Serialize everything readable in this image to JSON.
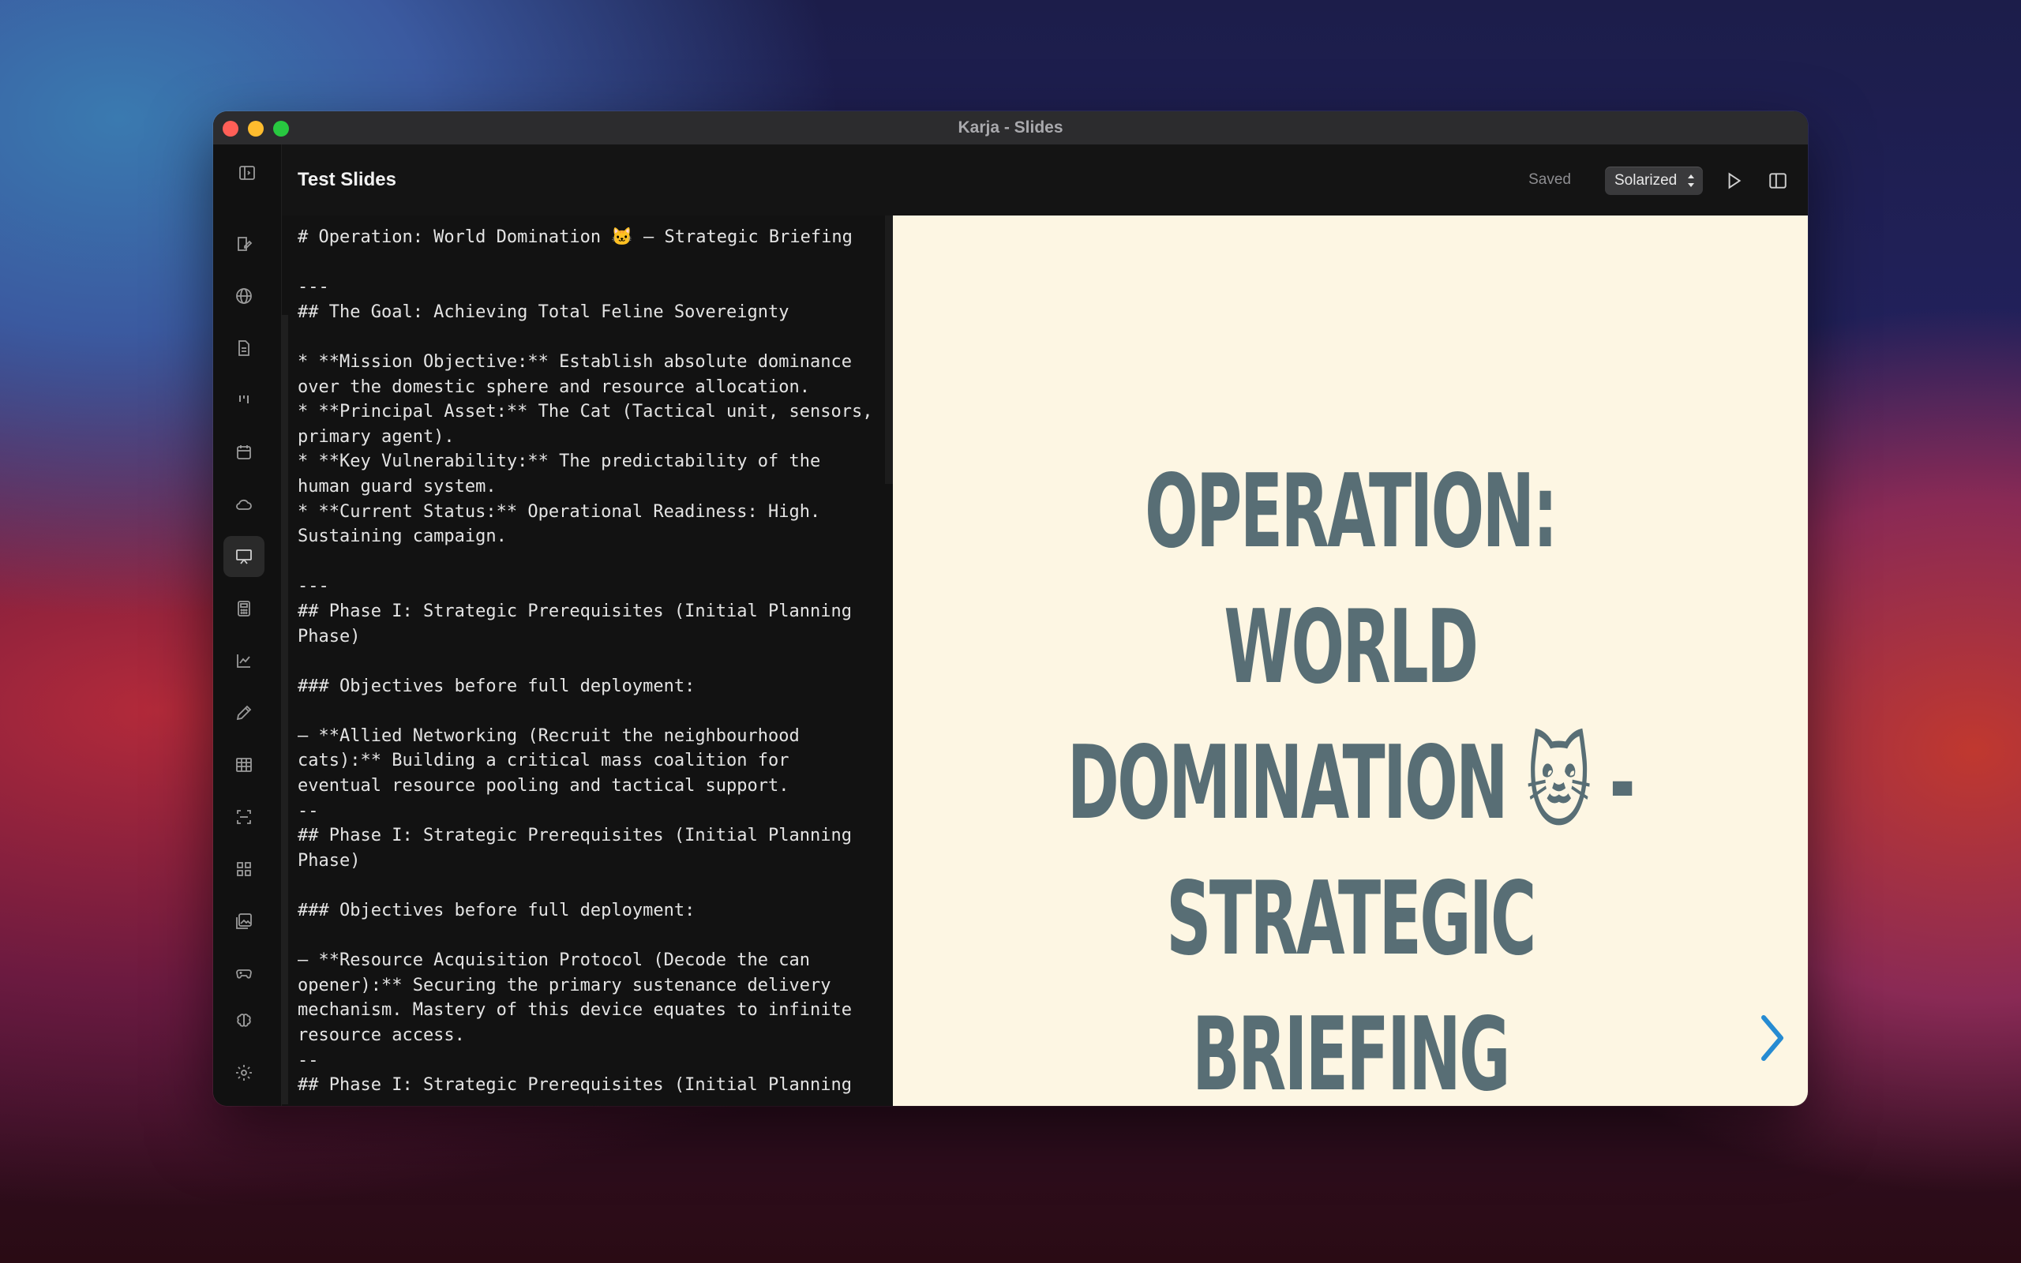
{
  "window": {
    "title": "Karja - Slides"
  },
  "header": {
    "doc_title": "Test Slides",
    "save_status": "Saved",
    "theme_select": {
      "selected": "Solarized"
    }
  },
  "sidebar": {
    "items": [
      {
        "icon": "notes-edit-icon"
      },
      {
        "icon": "globe-icon"
      },
      {
        "icon": "document-icon"
      },
      {
        "icon": "kanban-icon"
      },
      {
        "icon": "calendar-icon"
      },
      {
        "icon": "cloud-icon"
      },
      {
        "icon": "presentation-icon",
        "active": true
      },
      {
        "icon": "calculator-icon"
      },
      {
        "icon": "chart-icon"
      },
      {
        "icon": "pencil-icon"
      },
      {
        "icon": "table-icon"
      },
      {
        "icon": "scan-icon"
      },
      {
        "icon": "grid-icon"
      },
      {
        "icon": "images-icon"
      },
      {
        "icon": "gamepad-icon"
      },
      {
        "icon": "brain-icon"
      },
      {
        "icon": "settings-icon"
      }
    ]
  },
  "editor": {
    "content": "# Operation: World Domination 🐱 – Strategic Briefing\n\n---\n## The Goal: Achieving Total Feline Sovereignty\n\n* **Mission Objective:** Establish absolute dominance over the domestic sphere and resource allocation.\n* **Principal Asset:** The Cat (Tactical unit, sensors, primary agent).\n* **Key Vulnerability:** The predictability of the human guard system.\n* **Current Status:** Operational Readiness: High. Sustaining campaign.\n\n---\n## Phase I: Strategic Prerequisites (Initial Planning Phase)\n\n### Objectives before full deployment:\n\n– **Allied Networking (Recruit the neighbourhood cats):** Building a critical mass coalition for eventual resource pooling and tactical support.\n--\n## Phase I: Strategic Prerequisites (Initial Planning Phase)\n\n### Objectives before full deployment:\n\n– **Resource Acquisition Protocol (Decode the can opener):** Securing the primary sustenance delivery mechanism. Mastery of this device equates to infinite resource access.\n--\n## Phase I: Strategic Prerequisites (Initial Planning"
  },
  "preview": {
    "slide_title": "OPERATION: WORLD DOMINATION 🐱 - STRATEGIC BRIEFING",
    "background": "#fdf6e3",
    "text_color": "#586e75",
    "accent": "#268bd2"
  }
}
